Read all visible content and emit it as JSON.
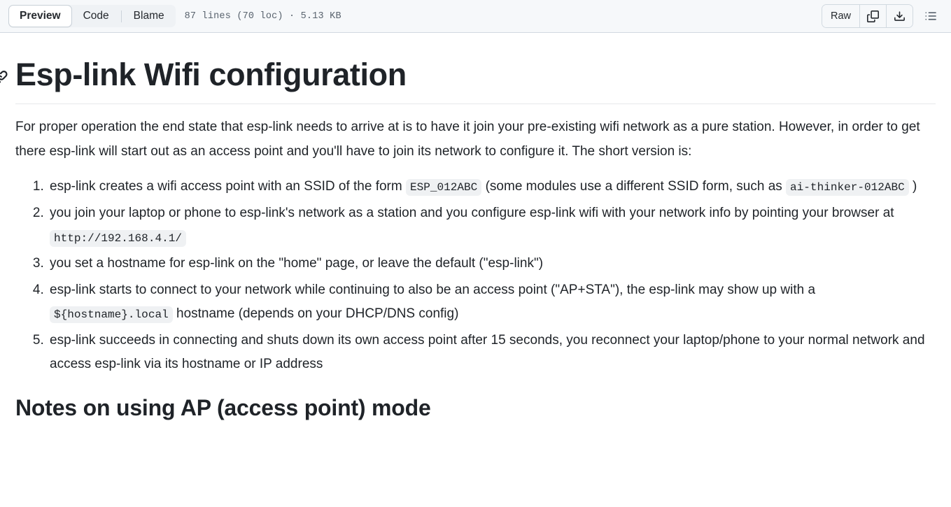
{
  "header": {
    "tabs": [
      {
        "label": "Preview",
        "active": true
      },
      {
        "label": "Code",
        "active": false
      },
      {
        "label": "Blame",
        "active": false
      }
    ],
    "file_meta": "87 lines (70 loc) · 5.13 KB",
    "raw_label": "Raw",
    "icons": {
      "copy": "copy-icon",
      "download": "download-icon",
      "outline": "outline-list-icon",
      "anchor": "link-anchor-icon"
    }
  },
  "document": {
    "title": "Esp-link Wifi configuration",
    "intro_paragraph": "For proper operation the end state that esp-link needs to arrive at is to have it join your pre-existing wifi network as a pure station. However, in order to get there esp-link will start out as an access point and you'll have to join its network to configure it. The short version is:",
    "steps": [
      {
        "parts": [
          {
            "type": "text",
            "value": "esp-link creates a wifi access point with an SSID of the form "
          },
          {
            "type": "code",
            "value": "ESP_012ABC"
          },
          {
            "type": "text",
            "value": " (some modules use a different SSID form, such as "
          },
          {
            "type": "code",
            "value": "ai-thinker-012ABC"
          },
          {
            "type": "text",
            "value": " )"
          }
        ]
      },
      {
        "parts": [
          {
            "type": "text",
            "value": "you join your laptop or phone to esp-link's network as a station and you configure esp-link wifi with your network info by pointing your browser at "
          },
          {
            "type": "code",
            "value": "http://192.168.4.1/"
          }
        ]
      },
      {
        "parts": [
          {
            "type": "text",
            "value": "you set a hostname for esp-link on the \"home\" page, or leave the default (\"esp-link\")"
          }
        ]
      },
      {
        "parts": [
          {
            "type": "text",
            "value": "esp-link starts to connect to your network while continuing to also be an access point (\"AP+STA\"), the esp-link may show up with a "
          },
          {
            "type": "code",
            "value": "${hostname}.local"
          },
          {
            "type": "text",
            "value": " hostname (depends on your DHCP/DNS config)"
          }
        ]
      },
      {
        "parts": [
          {
            "type": "text",
            "value": "esp-link succeeds in connecting and shuts down its own access point after 15 seconds, you reconnect your laptop/phone to your normal network and access esp-link via its hostname or IP address"
          }
        ]
      }
    ],
    "section_heading": "Notes on using AP (access point) mode"
  },
  "colors": {
    "header_bg": "#f6f8fa",
    "border": "#d1d9e0",
    "text": "#1f2328",
    "muted": "#59636e",
    "code_bg": "#eff1f3"
  }
}
